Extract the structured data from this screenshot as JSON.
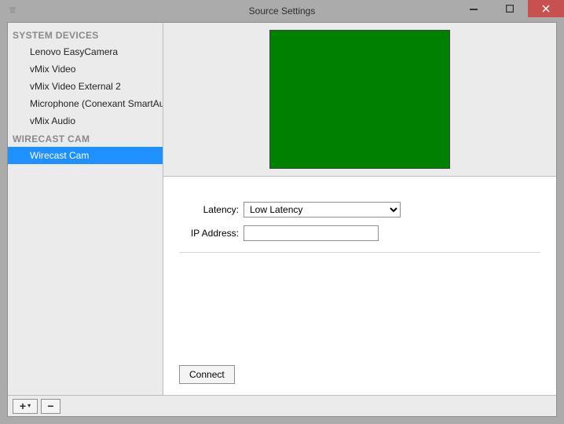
{
  "titlebar": {
    "title": "Source Settings"
  },
  "sidebar": {
    "sections": [
      {
        "header": "SYSTEM DEVICES",
        "items": [
          "Lenovo EasyCamera",
          "vMix Video",
          "vMix Video External 2",
          "Microphone (Conexant SmartAudio",
          "vMix Audio"
        ]
      },
      {
        "header": "WIRECAST CAM",
        "items": [
          "Wirecast Cam"
        ]
      }
    ],
    "selected": "Wirecast Cam"
  },
  "form": {
    "latency_label": "Latency:",
    "latency_value": "Low Latency",
    "latency_options": [
      "Low Latency"
    ],
    "ip_label": "IP Address:",
    "ip_value": "",
    "connect_label": "Connect"
  },
  "footer": {
    "add_label": "+",
    "remove_label": "−"
  }
}
